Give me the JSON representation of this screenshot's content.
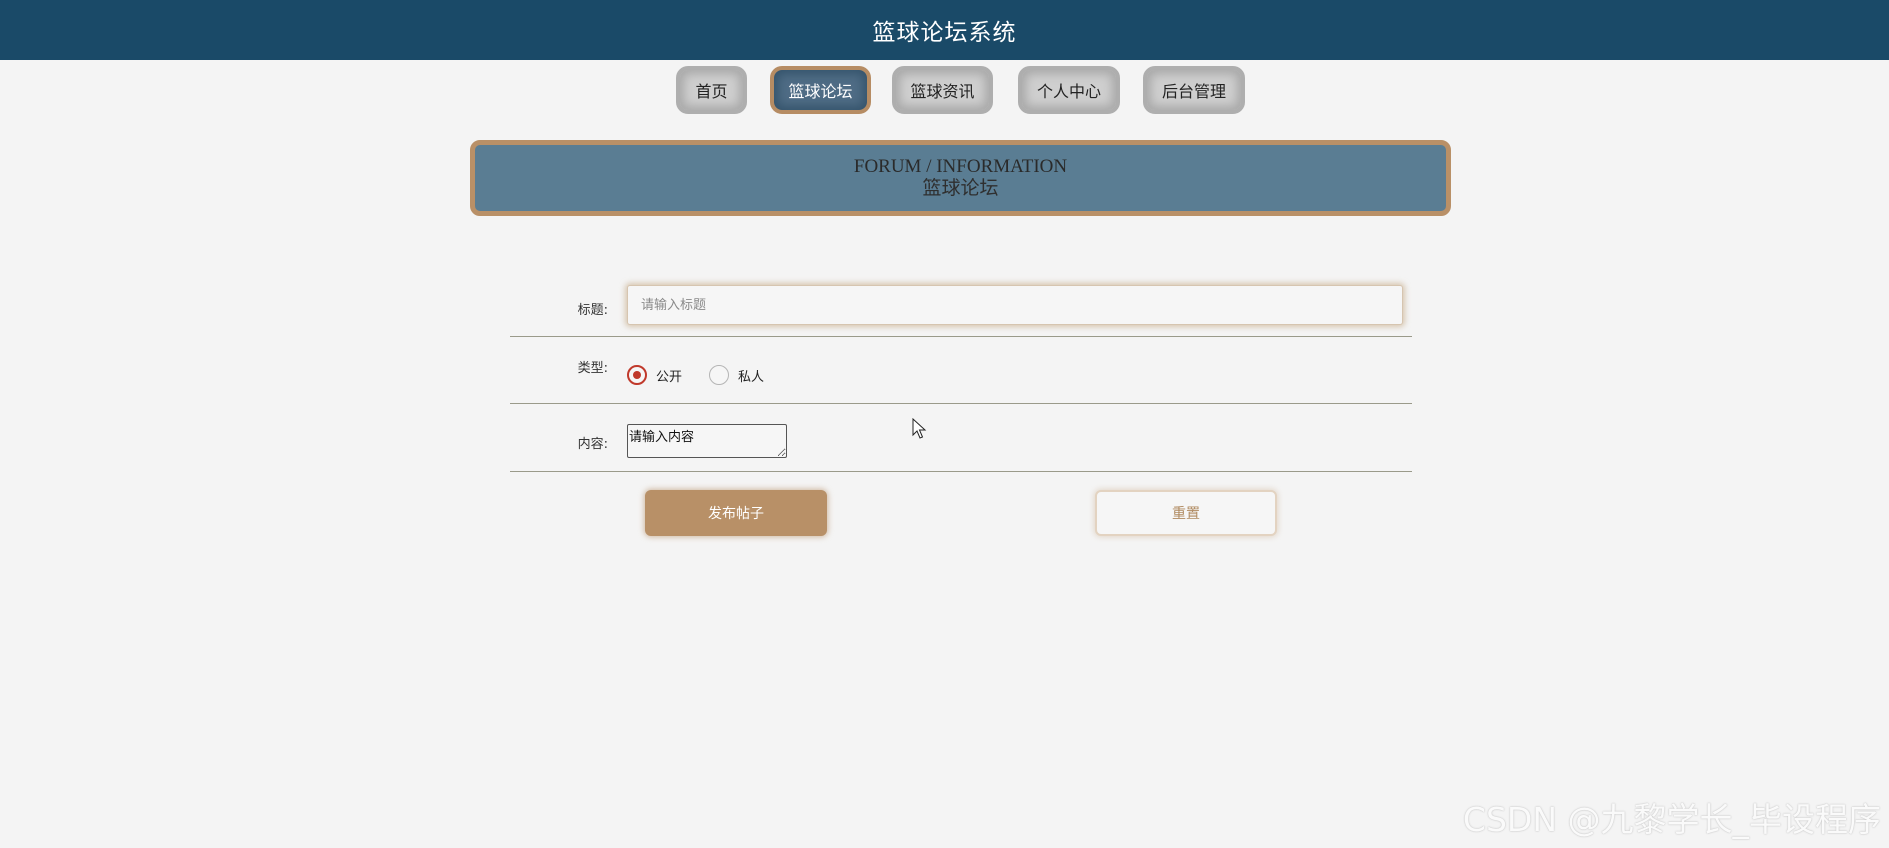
{
  "header": {
    "title": "篮球论坛系统"
  },
  "nav": {
    "items": [
      {
        "label": "首页"
      },
      {
        "label": "篮球论坛",
        "active": true
      },
      {
        "label": "篮球资讯"
      },
      {
        "label": "个人中心"
      },
      {
        "label": "后台管理"
      }
    ]
  },
  "banner": {
    "en": "FORUM / INFORMATION",
    "cn": "篮球论坛"
  },
  "form": {
    "title_label": "标题:",
    "title_placeholder": "请输入标题",
    "type_label": "类型:",
    "type_options": [
      {
        "label": "公开",
        "checked": true
      },
      {
        "label": "私人",
        "checked": false
      }
    ],
    "content_label": "内容:",
    "content_value": "请输入内容",
    "submit_label": "发布帖子",
    "reset_label": "重置"
  },
  "watermark": "CSDN @九黎学长_毕设程序",
  "colors": {
    "header_bg": "#1a4a68",
    "accent": "#b89067",
    "banner_bg": "#5a7d93",
    "radio_checked": "#c0392b"
  }
}
